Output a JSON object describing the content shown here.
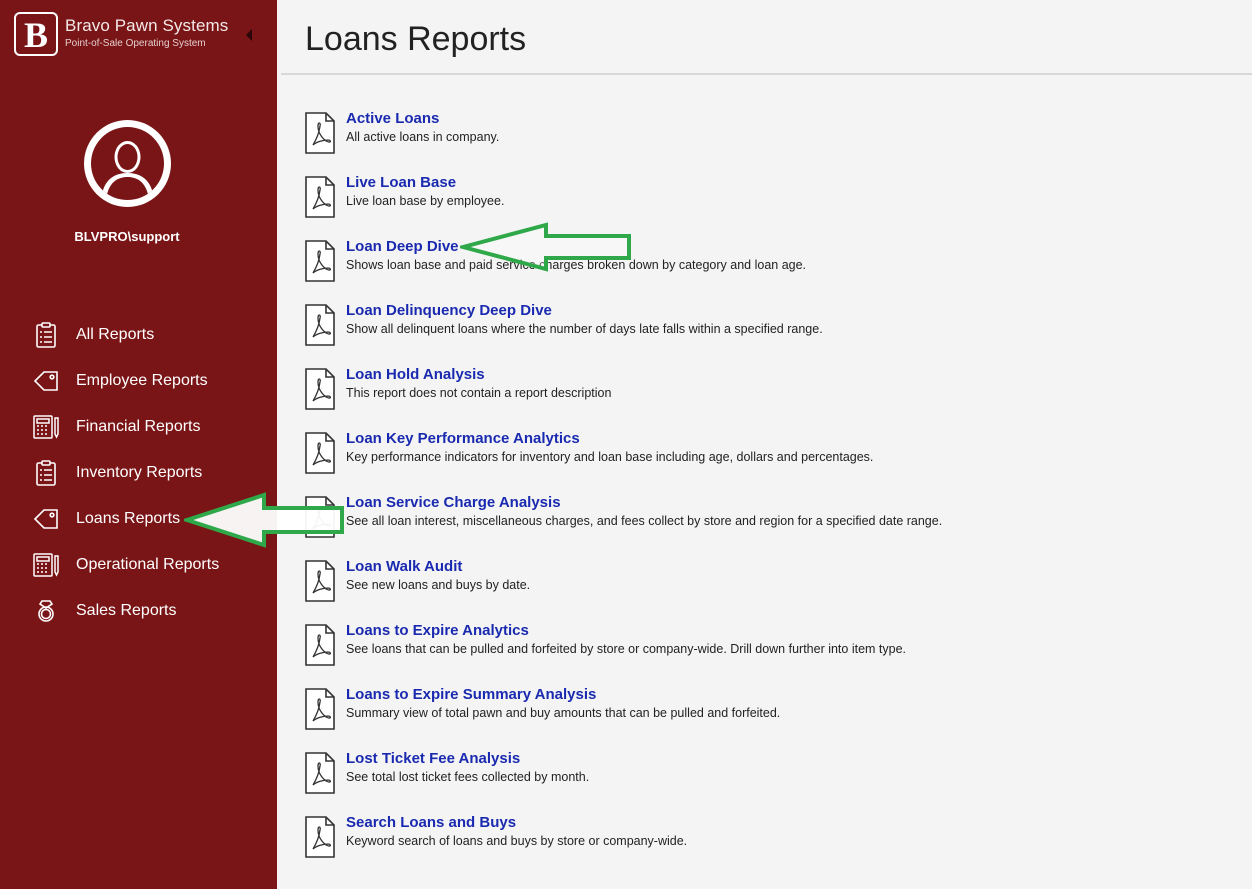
{
  "app": {
    "brand_name": "Bravo Pawn Systems",
    "brand_subtitle": "Point-of-Sale Operating System",
    "logo_letter": "B",
    "accent_color": "#7a1517"
  },
  "user": {
    "name": "BLVPRO\\support"
  },
  "sidebar": {
    "items": [
      {
        "label": "All Reports",
        "icon": "clipboard-list-icon"
      },
      {
        "label": "Employee Reports",
        "icon": "tag-icon"
      },
      {
        "label": "Financial Reports",
        "icon": "calculator-icon"
      },
      {
        "label": "Inventory Reports",
        "icon": "clipboard-list-icon"
      },
      {
        "label": "Loans Reports",
        "icon": "tag-icon",
        "active": true
      },
      {
        "label": "Operational Reports",
        "icon": "calculator-icon"
      },
      {
        "label": "Sales Reports",
        "icon": "ring-icon"
      }
    ]
  },
  "page": {
    "title": "Loans Reports"
  },
  "reports": [
    {
      "title": "Active Loans",
      "description": "All active loans in company."
    },
    {
      "title": "Live Loan Base",
      "description": "Live loan base by employee."
    },
    {
      "title": "Loan Deep Dive",
      "description": "Shows loan base and paid service charges broken down by category and loan age."
    },
    {
      "title": "Loan Delinquency Deep Dive",
      "description": "Show all delinquent loans where the number of days late falls within a specified range."
    },
    {
      "title": "Loan Hold Analysis",
      "description": "This report does not contain a report description"
    },
    {
      "title": "Loan Key Performance Analytics",
      "description": "Key performance indicators for inventory and loan base including age, dollars and percentages."
    },
    {
      "title": "Loan Service Charge Analysis",
      "description": "See all loan interest, miscellaneous charges, and fees collect by store and region for a specified date range."
    },
    {
      "title": "Loan Walk Audit",
      "description": "See new loans and buys by date."
    },
    {
      "title": "Loans to Expire Analytics",
      "description": "See loans that can be pulled and forfeited by store or company-wide. Drill down further into item type."
    },
    {
      "title": "Loans to Expire Summary Analysis",
      "description": "Summary view of total pawn and buy amounts that can be pulled and forfeited."
    },
    {
      "title": "Lost Ticket Fee Analysis",
      "description": "See total lost ticket fees collected by month."
    },
    {
      "title": "Search Loans and Buys",
      "description": "Keyword search of loans and buys by store or company-wide."
    }
  ],
  "annotations": {
    "arrow_color": "#2fa84a"
  }
}
